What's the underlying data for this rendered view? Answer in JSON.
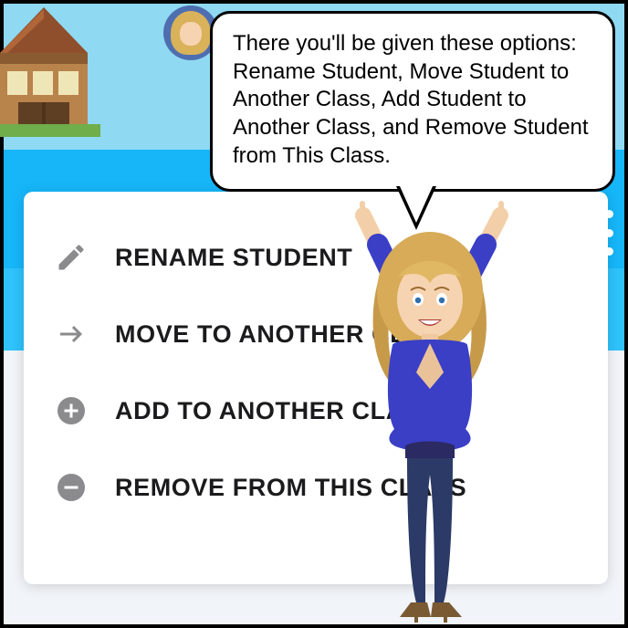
{
  "bubble": {
    "text": "There you'll be given these options: Rename Student, Move Student to Another Class, Add Student to Another Class, and Remove Student from This Class."
  },
  "menu": {
    "items": [
      {
        "label": "RENAME STUDENT"
      },
      {
        "label": "MOVE TO ANOTHER CLASS"
      },
      {
        "label": "ADD TO ANOTHER CLASS"
      },
      {
        "label": "REMOVE FROM THIS CLASS"
      }
    ]
  }
}
